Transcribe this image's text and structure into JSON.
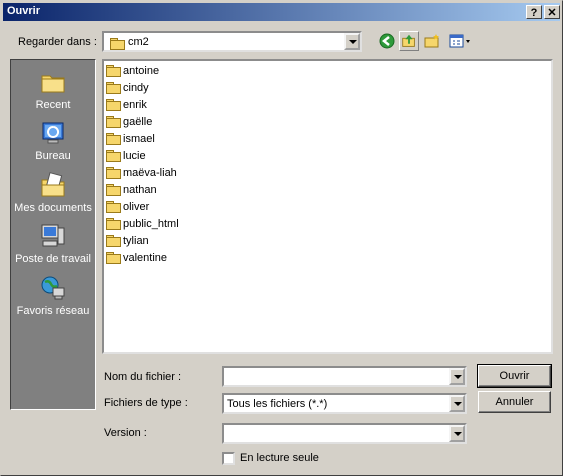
{
  "window": {
    "title": "Ouvrir",
    "help_glyph": "?",
    "close_glyph": "✕"
  },
  "lookin": {
    "label": "Regarder dans :",
    "value": "cm2"
  },
  "places": [
    {
      "label": "Recent",
      "icon": "recent-folder-icon"
    },
    {
      "label": "Bureau",
      "icon": "desktop-icon"
    },
    {
      "label": "Mes documents",
      "icon": "my-documents-icon"
    },
    {
      "label": "Poste de travail",
      "icon": "my-computer-icon"
    },
    {
      "label": "Favoris réseau",
      "icon": "network-places-icon"
    }
  ],
  "files": [
    "antoine",
    "cindy",
    "enrik",
    "gaëlle",
    "ismael",
    "lucie",
    "maëva-liah",
    "nathan",
    "oliver",
    "public_html",
    "tylian",
    "valentine"
  ],
  "form": {
    "filename_label": "Nom du fichier :",
    "filename_value": "",
    "filetype_label": "Fichiers de type :",
    "filetype_value": "Tous les fichiers (*.*)",
    "version_label": "Version :",
    "version_value": "",
    "readonly_label": "En lecture seule"
  },
  "buttons": {
    "open": "Ouvrir",
    "cancel": "Annuler"
  },
  "colors": {
    "title_start": "#0a246a",
    "title_end": "#a6caf0",
    "places_bg": "#808080",
    "face": "#d4d0c8"
  }
}
